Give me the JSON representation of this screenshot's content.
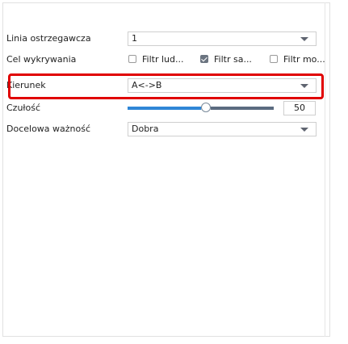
{
  "form": {
    "warning_line": {
      "label": "Linia ostrzegawcza",
      "value": "1"
    },
    "detection_target": {
      "label": "Cel wykrywania",
      "options": [
        {
          "label": "Filtr lud...",
          "checked": false
        },
        {
          "label": "Filtr sa...",
          "checked": true
        },
        {
          "label": "Filtr mo...",
          "checked": false
        }
      ]
    },
    "direction": {
      "label": "Kierunek",
      "value": "A<->B"
    },
    "sensitivity": {
      "label": "Czułość",
      "value": "50",
      "fraction": 0.5
    },
    "target_validity": {
      "label": "Docelowa ważność",
      "value": "Dobra"
    }
  },
  "colors": {
    "highlight": "#e00000",
    "slider_fill": "#2f86d6",
    "slider_fill_right": "#5b6b80"
  }
}
